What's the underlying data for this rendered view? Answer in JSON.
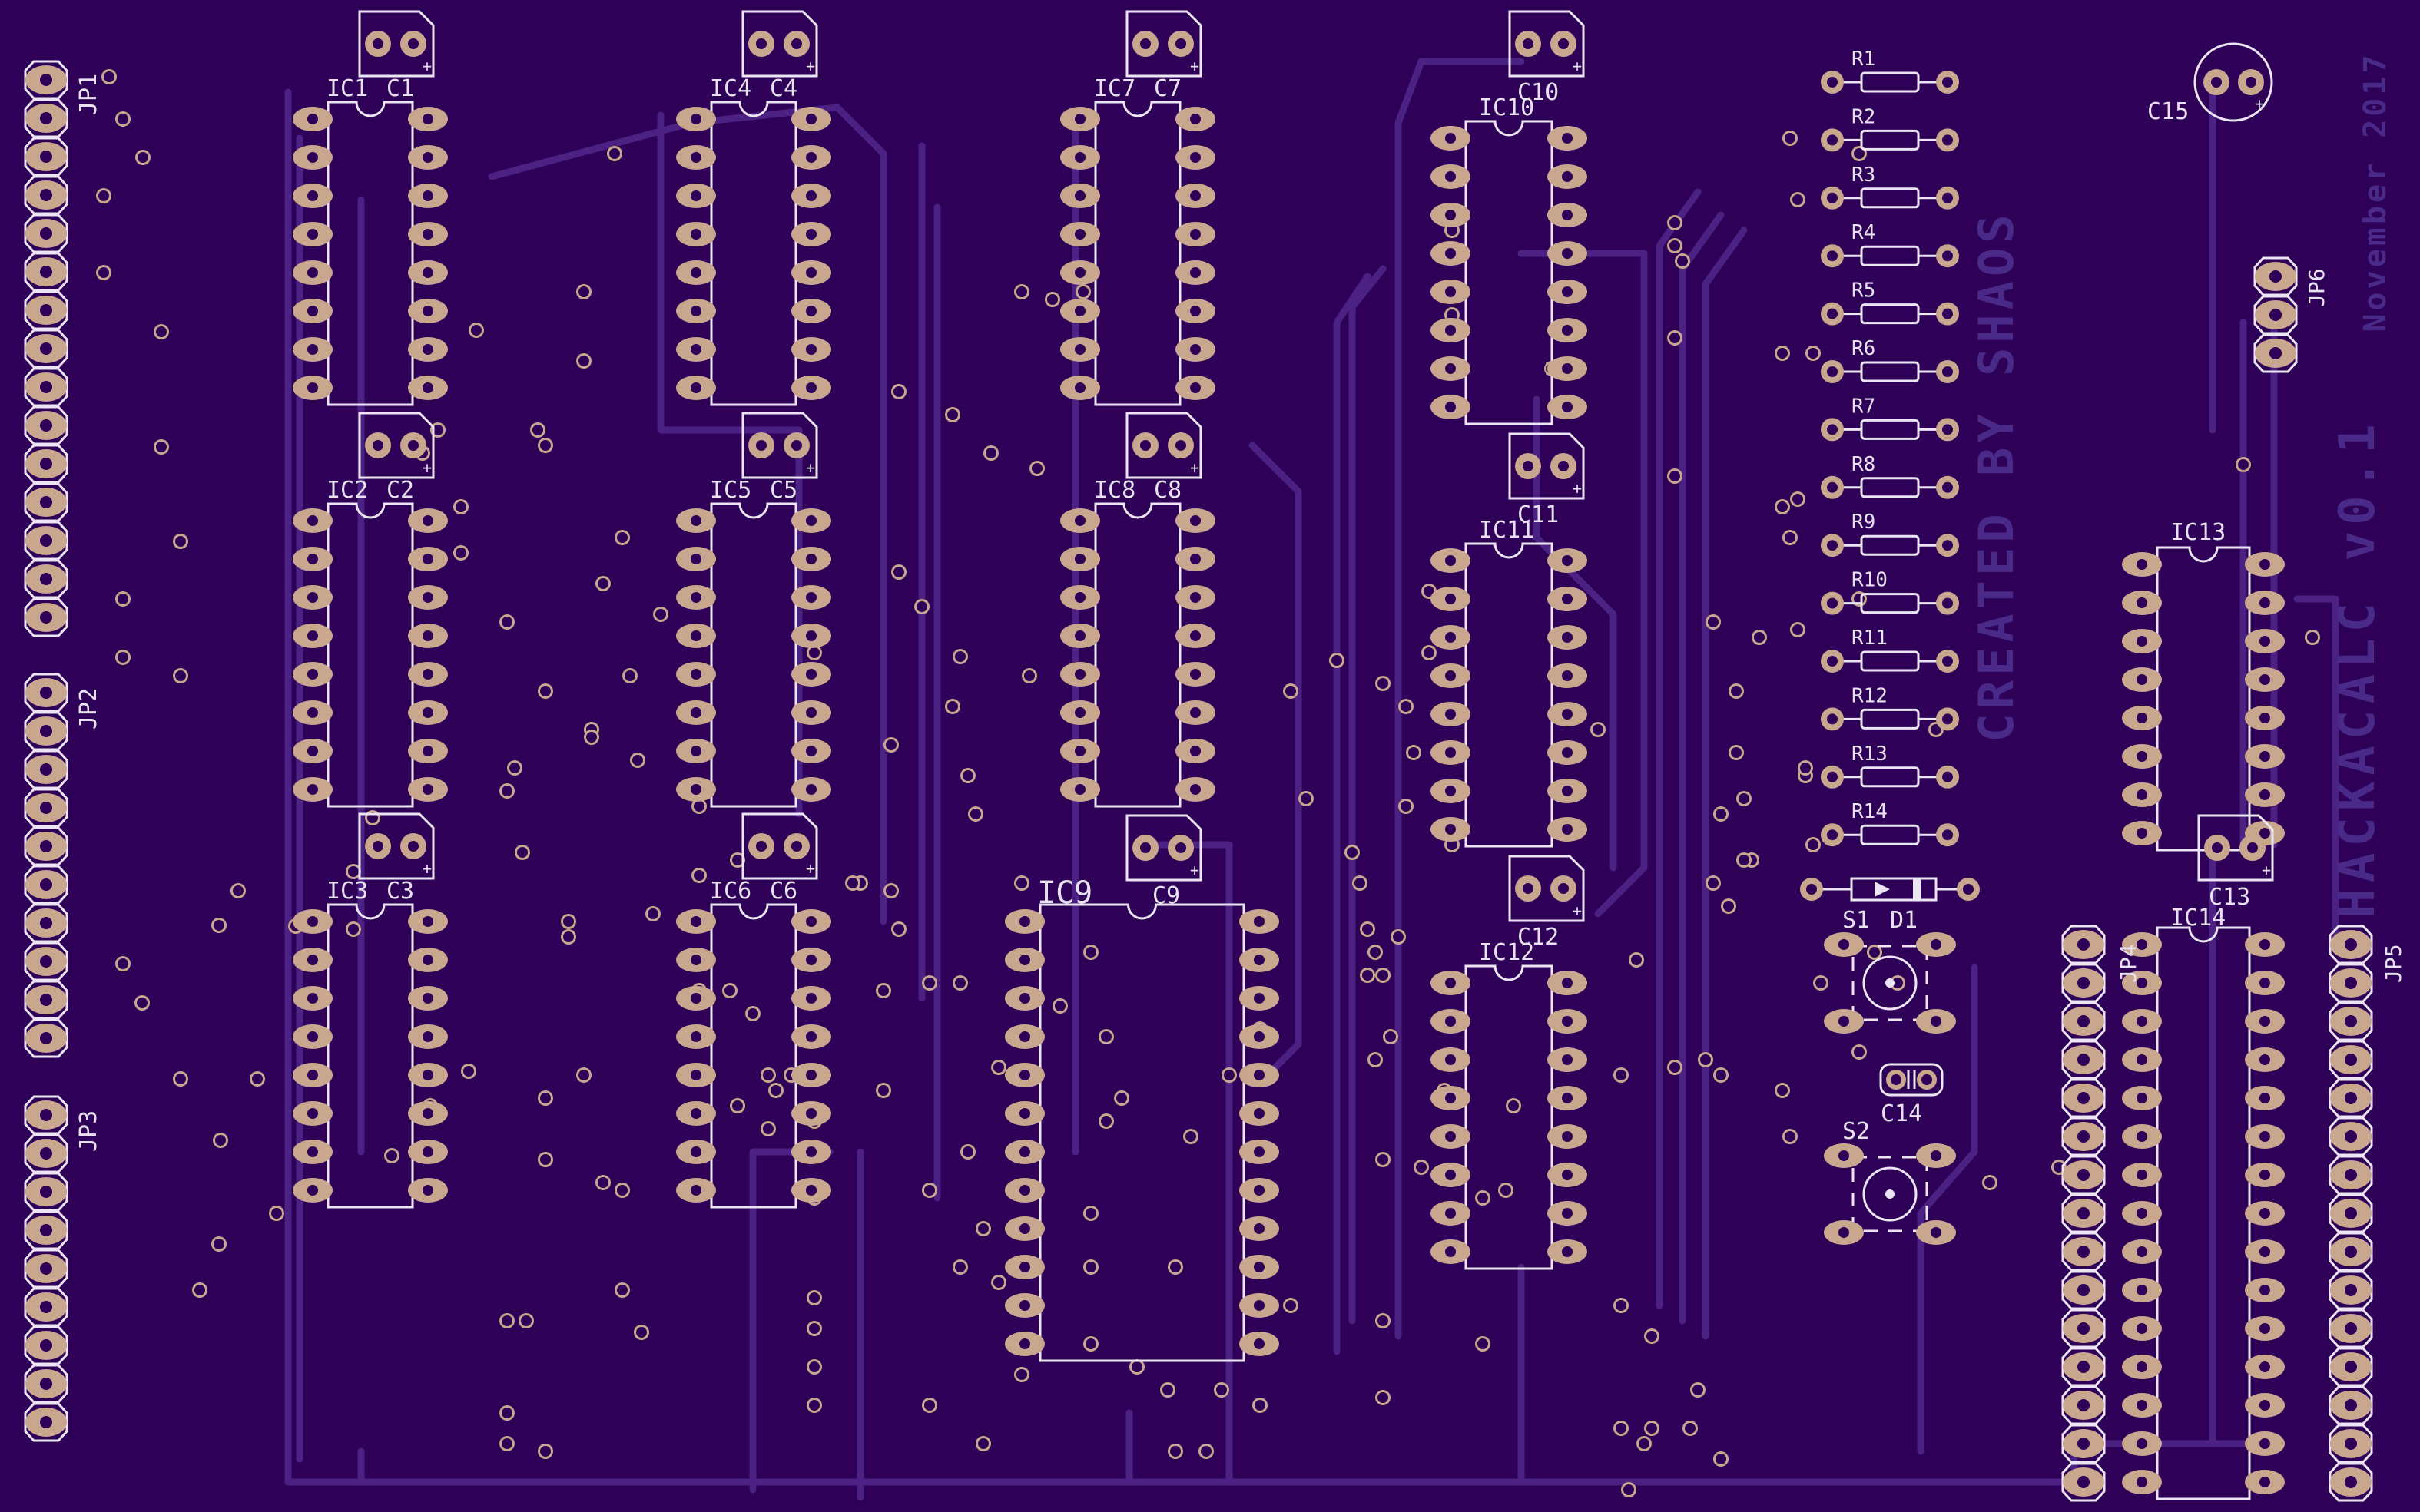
{
  "board": {
    "colors": {
      "background": "#2e0058",
      "trace": "#4b2283",
      "pad": "#c9a68e",
      "silkscreen": "#ece6f4",
      "faint_text": "#4a2a88"
    },
    "watermarks": {
      "created_by": "CREATED BY SHAOS",
      "project": "HACKACALC v0.1",
      "date": "November 2017"
    }
  },
  "components": {
    "ic_labels": [
      "IC1",
      "IC2",
      "IC3",
      "IC4",
      "IC5",
      "IC6",
      "IC7",
      "IC8",
      "IC9",
      "IC10",
      "IC11",
      "IC12",
      "IC13",
      "IC14"
    ],
    "capacitor_labels": [
      "C1",
      "C2",
      "C3",
      "C4",
      "C5",
      "C6",
      "C7",
      "C8",
      "C9",
      "C10",
      "C11",
      "C12",
      "C13",
      "C14",
      "C15"
    ],
    "resistor_labels": [
      "R1",
      "R2",
      "R3",
      "R4",
      "R5",
      "R6",
      "R7",
      "R8",
      "R9",
      "R10",
      "R11",
      "R12",
      "R13",
      "R14"
    ],
    "jumper_labels": [
      "JP1",
      "JP2",
      "JP3",
      "JP4",
      "JP5",
      "JP6"
    ],
    "switch_labels": [
      "S1",
      "S2"
    ],
    "diode_label": "D1"
  }
}
